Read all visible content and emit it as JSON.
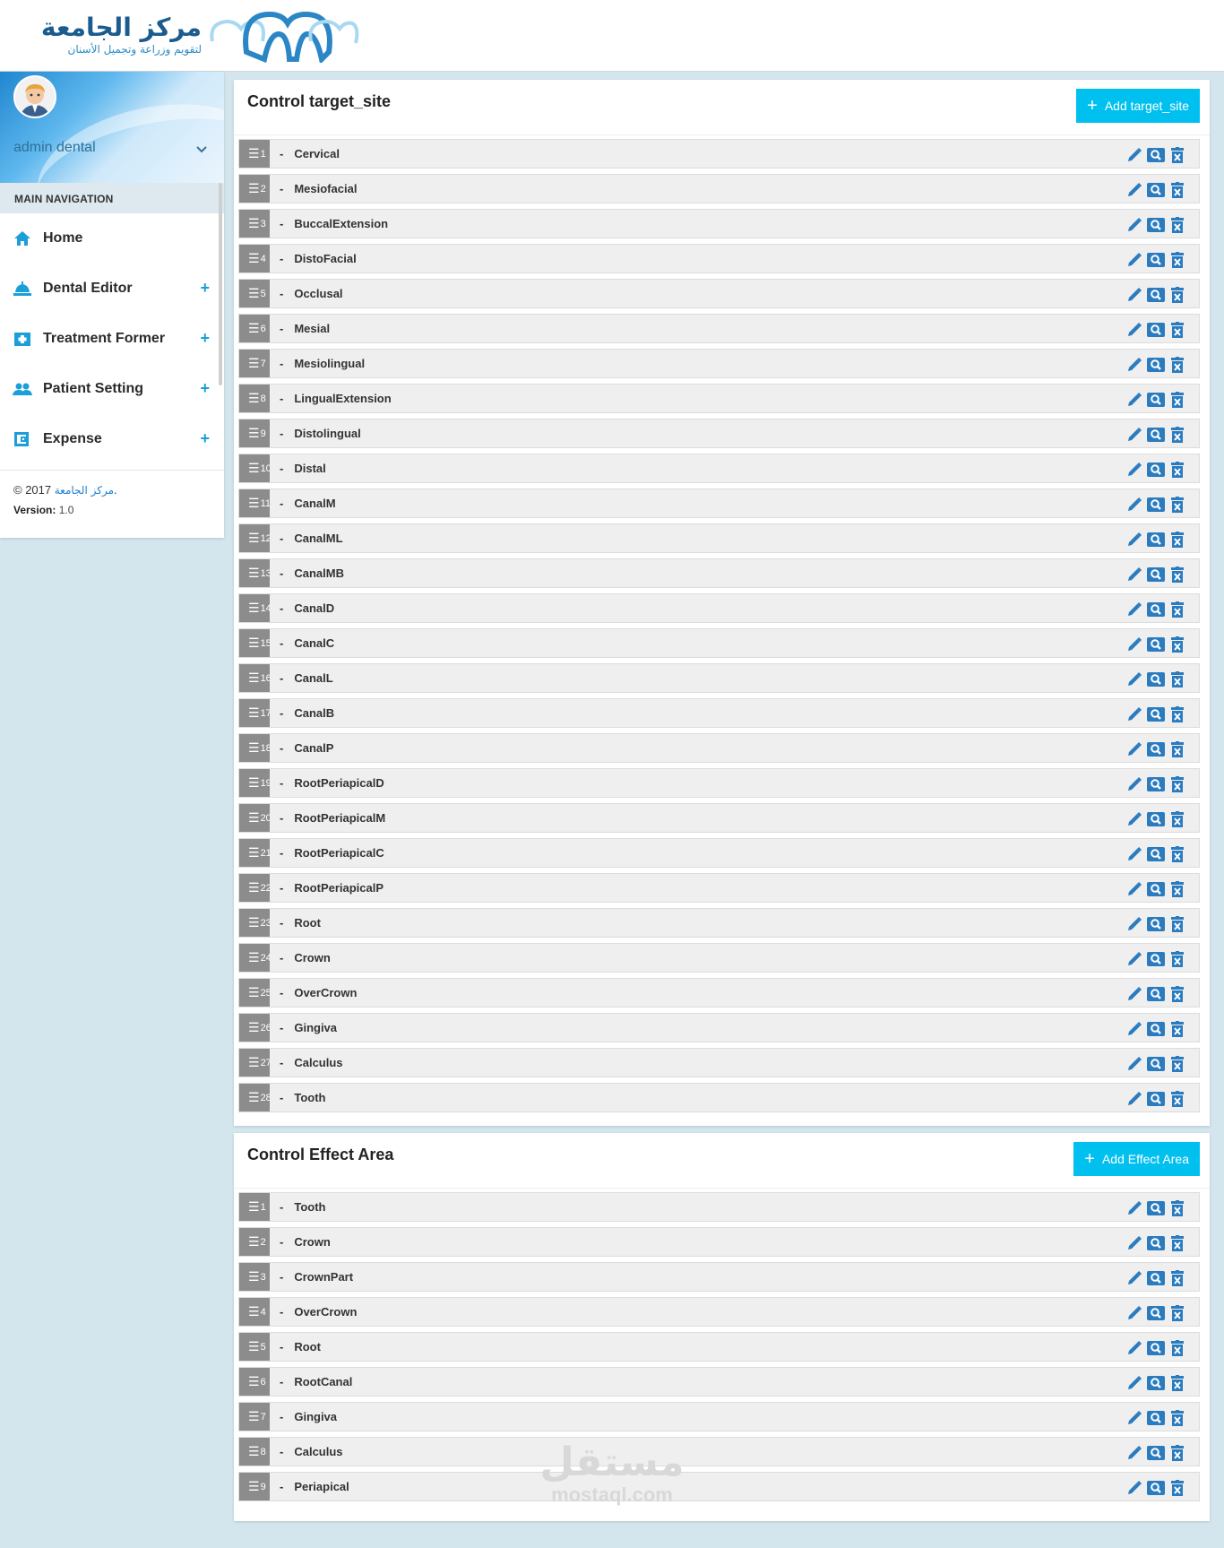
{
  "brand": {
    "title": "مركز الجامعة",
    "subtitle": "لتقويم وزراعة وتجميل الأسنان"
  },
  "user": {
    "name": "admin dental"
  },
  "nav": {
    "header": "MAIN NAVIGATION",
    "items": [
      {
        "label": "Home",
        "icon": "home-icon",
        "expandable": false
      },
      {
        "label": "Dental Editor",
        "icon": "dental-chair-icon",
        "expandable": true
      },
      {
        "label": "Treatment Former",
        "icon": "medical-kit-icon",
        "expandable": true
      },
      {
        "label": "Patient Setting",
        "icon": "people-icon",
        "expandable": true
      },
      {
        "label": "Expense",
        "icon": "wallet-icon",
        "expandable": true
      }
    ],
    "expand_symbol": "+"
  },
  "footer": {
    "copyright_prefix": "© 2017",
    "copyright_link": "مركز الجامعة",
    "copyright_suffix": ".",
    "version_label": "Version:",
    "version_value": "1.0"
  },
  "target_site": {
    "title": "Control target_site",
    "add_label": "Add target_site",
    "items": [
      "Cervical",
      "Mesiofacial",
      "BuccalExtension",
      "DistoFacial",
      "Occlusal",
      "Mesial",
      "Mesiolingual",
      "LingualExtension",
      "Distolingual",
      "Distal",
      "CanalM",
      "CanalML",
      "CanalMB",
      "CanalD",
      "CanalC",
      "CanalL",
      "CanalB",
      "CanalP",
      "RootPeriapicalD",
      "RootPeriapicalM",
      "RootPeriapicalC",
      "RootPeriapicalP",
      "Root",
      "Crown",
      "OverCrown",
      "Gingiva",
      "Calculus",
      "Tooth"
    ]
  },
  "effect_area": {
    "title": "Control Effect Area",
    "add_label": "Add Effect Area",
    "items": [
      "Tooth",
      "Crown",
      "CrownPart",
      "OverCrown",
      "Root",
      "RootCanal",
      "Gingiva",
      "Calculus",
      "Periapical"
    ]
  },
  "row_handle_symbol": "☰",
  "row_separator": "-",
  "icons": {
    "edit": "pencil-icon",
    "view": "search-icon",
    "delete": "trash-icon"
  },
  "colors": {
    "accent": "#00c0ef",
    "icon_blue": "#2b7bbf",
    "handle_gray": "#8c8c8c",
    "page_bg": "#d4e6ed"
  },
  "watermark": {
    "arabic": "مستقل",
    "latin": "mostaql.com"
  }
}
